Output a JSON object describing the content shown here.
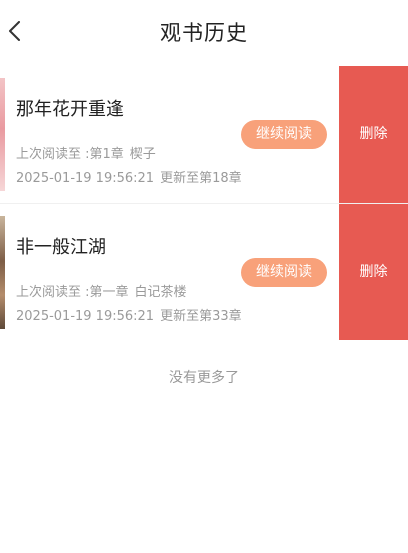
{
  "header": {
    "title": "观书历史",
    "back_icon": "chevron-left-icon"
  },
  "history": [
    {
      "title": "那年花开重逢",
      "progress_label": "上次阅读至 :第1章",
      "chapter_name": "楔子",
      "timestamp": "2025-01-19 19:56:21",
      "update_info": "更新至第18章",
      "continue_label": "继续阅读",
      "delete_label": "删除"
    },
    {
      "title": "非一般江湖",
      "progress_label": "上次阅读至 :第一章",
      "chapter_name": "白记茶楼",
      "timestamp": "2025-01-19 19:56:21",
      "update_info": "更新至第33章",
      "continue_label": "继续阅读",
      "delete_label": "删除"
    }
  ],
  "list_end_text": "没有更多了",
  "colors": {
    "continue_button": "#f8a17a",
    "delete_button": "#e75a52",
    "secondary_text": "#9a9a9a"
  }
}
